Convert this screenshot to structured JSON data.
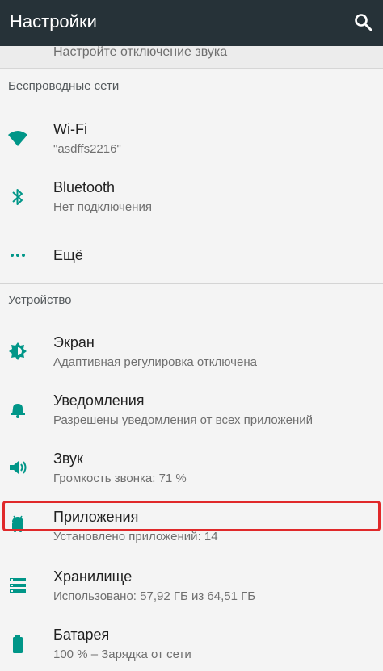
{
  "header": {
    "title": "Настройки",
    "search_icon": "search-icon"
  },
  "partial_item": {
    "subtitle": "Настройте отключение звука"
  },
  "sections": {
    "wireless": "Беспроводные сети",
    "device": "Устройство"
  },
  "wireless_items": [
    {
      "title": "Wi-Fi",
      "subtitle": "\"asdffs2216\"",
      "icon": "wifi-icon"
    },
    {
      "title": "Bluetooth",
      "subtitle": "Нет подключения",
      "icon": "bluetooth-icon"
    },
    {
      "title": "Ещё",
      "icon": "more-dots-icon"
    }
  ],
  "device_items": [
    {
      "title": "Экран",
      "subtitle": "Адаптивная регулировка отключена",
      "icon": "brightness-icon"
    },
    {
      "title": "Уведомления",
      "subtitle": "Разрешены уведомления от всех приложений",
      "icon": "bell-icon"
    },
    {
      "title": "Звук",
      "subtitle": "Громкость звонка: 71 %",
      "icon": "volume-icon"
    },
    {
      "title": "Приложения",
      "subtitle": "Установлено приложений: 14",
      "icon": "android-icon",
      "highlighted": true
    },
    {
      "title": "Хранилище",
      "subtitle": "Использовано: 57,92 ГБ из 64,51 ГБ",
      "icon": "storage-icon"
    },
    {
      "title": "Батарея",
      "subtitle": "100 % – Зарядка от сети",
      "icon": "battery-icon"
    }
  ],
  "colors": {
    "toolbar": "#263238",
    "accent": "#009688",
    "highlight": "#e0292a"
  }
}
